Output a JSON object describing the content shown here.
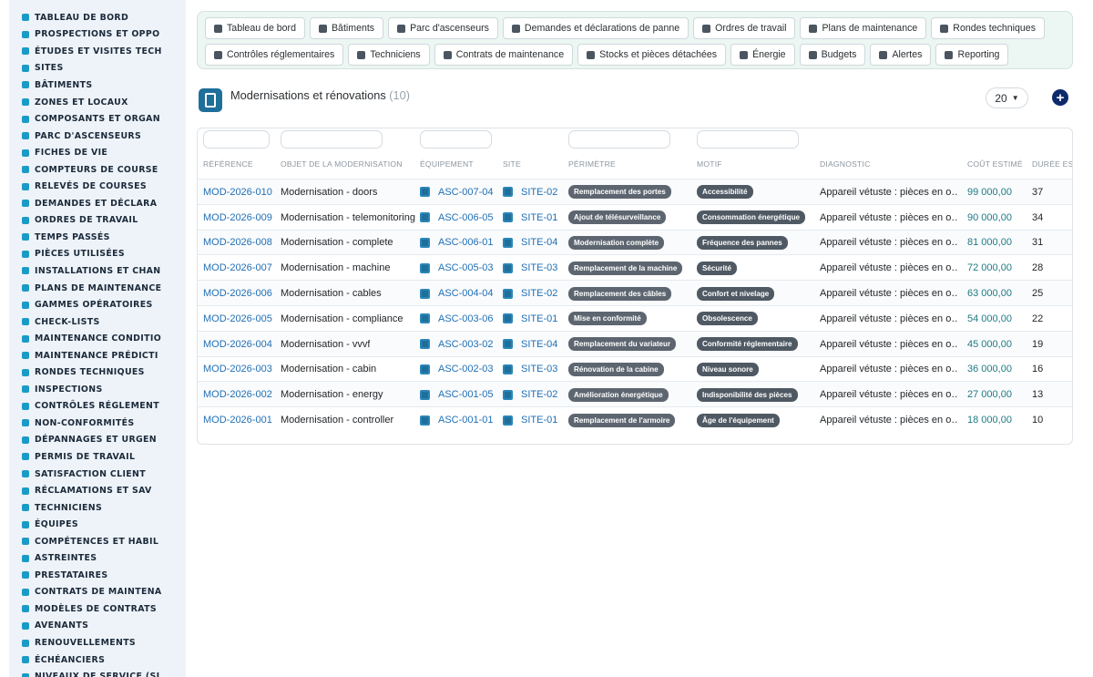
{
  "sidebar": {
    "items": [
      {
        "label": "TABLEAU DE BORD",
        "icon": "dashboard-icon"
      },
      {
        "label": "PROSPECTIONS ET OPPO",
        "icon": "target-icon"
      },
      {
        "label": "ÉTUDES ET VISITES TECH",
        "icon": "ruler-icon"
      },
      {
        "label": "SITES",
        "icon": "map-pin-icon"
      },
      {
        "label": "BÂTIMENTS",
        "icon": "building-icon"
      },
      {
        "label": "ZONES ET LOCAUX",
        "icon": "layers-icon"
      },
      {
        "label": "COMPOSANTS ET ORGAN",
        "icon": "sitemap-icon"
      },
      {
        "label": "PARC D'ASCENSEURS",
        "icon": "gears-icon"
      },
      {
        "label": "FICHES DE VIE",
        "icon": "history-icon"
      },
      {
        "label": "COMPTEURS DE COURSE",
        "icon": "gauge-icon"
      },
      {
        "label": "RELEVÉS DE COURSES",
        "icon": "clipboard-icon"
      },
      {
        "label": "DEMANDES ET DÉCLARA",
        "icon": "question-icon"
      },
      {
        "label": "ORDRES DE TRAVAIL",
        "icon": "clipboard-check-icon"
      },
      {
        "label": "TEMPS PASSÉS",
        "icon": "clock-icon"
      },
      {
        "label": "PIÈCES UTILISÉES",
        "icon": "boxes-icon"
      },
      {
        "label": "INSTALLATIONS ET CHAN",
        "icon": "hammer-icon"
      },
      {
        "label": "PLANS DE MAINTENANCE",
        "icon": "calendar-icon"
      },
      {
        "label": "GAMMES OPÉRATOIRES",
        "icon": "list-icon"
      },
      {
        "label": "CHECK-LISTS",
        "icon": "checklist-icon"
      },
      {
        "label": "MAINTENANCE CONDITIO",
        "icon": "thermometer-icon"
      },
      {
        "label": "MAINTENANCE PRÉDICTI",
        "icon": "chart-line-icon"
      },
      {
        "label": "RONDES TECHNIQUES",
        "icon": "route-icon"
      },
      {
        "label": "INSPECTIONS",
        "icon": "search-icon"
      },
      {
        "label": "CONTRÔLES RÉGLEMENT",
        "icon": "clipboard-list-icon"
      },
      {
        "label": "NON-CONFORMITÉS",
        "icon": "alert-circle-icon"
      },
      {
        "label": "DÉPANNAGES ET URGEN",
        "icon": "warning-icon"
      },
      {
        "label": "PERMIS DE TRAVAIL",
        "icon": "file-icon"
      },
      {
        "label": "SATISFACTION CLIENT",
        "icon": "smile-icon"
      },
      {
        "label": "RÉCLAMATIONS ET SAV",
        "icon": "comment-icon"
      },
      {
        "label": "TECHNICIENS",
        "icon": "list-icon"
      },
      {
        "label": "ÉQUIPES",
        "icon": "users-icon"
      },
      {
        "label": "COMPÉTENCES ET HABIL",
        "icon": "certificate-icon"
      },
      {
        "label": "ASTREINTES",
        "icon": "phone-icon"
      },
      {
        "label": "PRESTATAIRES",
        "icon": "handshake-icon"
      },
      {
        "label": "CONTRATS DE MAINTENA",
        "icon": "file-contract-icon"
      },
      {
        "label": "MODÈLES DE CONTRATS",
        "icon": "file-alt-icon"
      },
      {
        "label": "AVENANTS",
        "icon": "file-signature-icon"
      },
      {
        "label": "RENOUVELLEMENTS",
        "icon": "sync-icon"
      },
      {
        "label": "ÉCHÉANCIERS",
        "icon": "file-invoice-icon"
      },
      {
        "label": "NIVEAUX DE SERVICE (SL",
        "icon": "flag-icon"
      }
    ]
  },
  "topnav": {
    "row1": [
      {
        "label": "Tableau de bord",
        "icon": "dashboard-icon"
      },
      {
        "label": "Bâtiments",
        "icon": "building-icon"
      },
      {
        "label": "Parc d'ascenseurs",
        "icon": "gears-icon"
      },
      {
        "label": "Demandes et déclarations de panne",
        "icon": "question-icon"
      },
      {
        "label": "Ordres de travail",
        "icon": "clipboard-check-icon"
      },
      {
        "label": "Plans de maintenance",
        "icon": "calendar-icon"
      },
      {
        "label": "Rondes techniques",
        "icon": "route-icon"
      }
    ],
    "row2": [
      {
        "label": "Contrôles réglementaires",
        "icon": "clipboard-list-icon"
      },
      {
        "label": "Techniciens",
        "icon": "hard-hat-icon"
      },
      {
        "label": "Contrats de maintenance",
        "icon": "file-contract-icon"
      },
      {
        "label": "Stocks et pièces détachées",
        "icon": "boxes-icon"
      },
      {
        "label": "Énergie",
        "icon": "bolt-icon"
      },
      {
        "label": "Budgets",
        "icon": "money-icon"
      },
      {
        "label": "Alertes",
        "icon": "bell-icon"
      },
      {
        "label": "Reporting",
        "icon": "chart-pie-icon"
      }
    ]
  },
  "page": {
    "title": "Modernisations et rénovations",
    "count": "(10)",
    "page_size": "20",
    "add_label": "+"
  },
  "table": {
    "columns": [
      "RÉFÉRENCE",
      "OBJET DE LA MODERNISATION",
      "ÉQUIPEMENT",
      "SITE",
      "PÉRIMÈTRE",
      "MOTIF",
      "DIAGNOSTIC",
      "COÛT ESTIMÉ",
      "DURÉE ES"
    ],
    "rows": [
      {
        "ref": "MOD-2026-010",
        "objet": "Modernisation - doors",
        "equip": "ASC-007-04",
        "site": "SITE-02",
        "perimetre": "Remplacement des portes",
        "motif": "Accessibilité",
        "diagnostic": "Appareil vétuste : pièces en o…",
        "cout": "99 000,00",
        "duree": "37"
      },
      {
        "ref": "MOD-2026-009",
        "objet": "Modernisation - telemonitoring",
        "equip": "ASC-006-05",
        "site": "SITE-01",
        "perimetre": "Ajout de télésurveillance",
        "motif": "Consommation énergétique",
        "diagnostic": "Appareil vétuste : pièces en o…",
        "cout": "90 000,00",
        "duree": "34"
      },
      {
        "ref": "MOD-2026-008",
        "objet": "Modernisation - complete",
        "equip": "ASC-006-01",
        "site": "SITE-04",
        "perimetre": "Modernisation complète",
        "motif": "Fréquence des pannes",
        "diagnostic": "Appareil vétuste : pièces en o…",
        "cout": "81 000,00",
        "duree": "31"
      },
      {
        "ref": "MOD-2026-007",
        "objet": "Modernisation - machine",
        "equip": "ASC-005-03",
        "site": "SITE-03",
        "perimetre": "Remplacement de la machine",
        "motif": "Sécurité",
        "diagnostic": "Appareil vétuste : pièces en o…",
        "cout": "72 000,00",
        "duree": "28"
      },
      {
        "ref": "MOD-2026-006",
        "objet": "Modernisation - cables",
        "equip": "ASC-004-04",
        "site": "SITE-02",
        "perimetre": "Remplacement des câbles",
        "motif": "Confort et nivelage",
        "diagnostic": "Appareil vétuste : pièces en o…",
        "cout": "63 000,00",
        "duree": "25"
      },
      {
        "ref": "MOD-2026-005",
        "objet": "Modernisation - compliance",
        "equip": "ASC-003-06",
        "site": "SITE-01",
        "perimetre": "Mise en conformité",
        "motif": "Obsolescence",
        "diagnostic": "Appareil vétuste : pièces en o…",
        "cout": "54 000,00",
        "duree": "22"
      },
      {
        "ref": "MOD-2026-004",
        "objet": "Modernisation - vvvf",
        "equip": "ASC-003-02",
        "site": "SITE-04",
        "perimetre": "Remplacement du variateur",
        "motif": "Conformité réglementaire",
        "diagnostic": "Appareil vétuste : pièces en o…",
        "cout": "45 000,00",
        "duree": "19"
      },
      {
        "ref": "MOD-2026-003",
        "objet": "Modernisation - cabin",
        "equip": "ASC-002-03",
        "site": "SITE-03",
        "perimetre": "Rénovation de la cabine",
        "motif": "Niveau sonore",
        "diagnostic": "Appareil vétuste : pièces en o…",
        "cout": "36 000,00",
        "duree": "16"
      },
      {
        "ref": "MOD-2026-002",
        "objet": "Modernisation - energy",
        "equip": "ASC-001-05",
        "site": "SITE-02",
        "perimetre": "Amélioration énergétique",
        "motif": "Indisponibilité des pièces",
        "diagnostic": "Appareil vétuste : pièces en o…",
        "cout": "27 000,00",
        "duree": "13"
      },
      {
        "ref": "MOD-2026-001",
        "objet": "Modernisation - controller",
        "equip": "ASC-001-01",
        "site": "SITE-01",
        "perimetre": "Remplacement de l'armoire",
        "motif": "Âge de l'équipement",
        "diagnostic": "Appareil vétuste : pièces en o…",
        "cout": "18 000,00",
        "duree": "10"
      }
    ]
  },
  "colors": {
    "accent": "#1a9bc6",
    "link": "#1f6fb5",
    "badge": "#5d6670",
    "topbar_bg": "#ecf6f2",
    "sidebar_bg": "#eef3f9",
    "add_button": "#0d2a6b"
  }
}
